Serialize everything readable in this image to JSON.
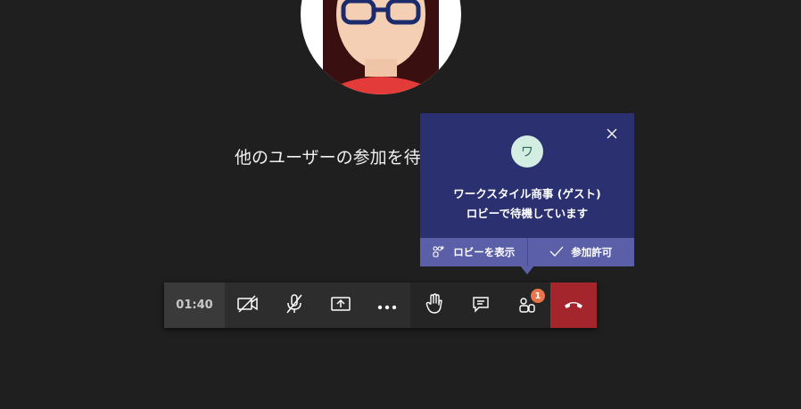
{
  "main": {
    "waiting_text": "他のユーザーの参加を待"
  },
  "lobby_popup": {
    "avatar_initial": "ワ",
    "participant_name": "ワークスタイル商事 (ゲスト)",
    "status": "ロビーで待機しています",
    "show_lobby_label": "ロビーを表示",
    "admit_label": "参加許可",
    "close_icon": "close-icon"
  },
  "toolbar": {
    "timer": "01:40",
    "participants_badge": "1",
    "icons": [
      "camera-off-icon",
      "mic-off-icon",
      "share-screen-icon",
      "more-icon",
      "raise-hand-icon",
      "chat-icon",
      "participants-icon",
      "hang-up-icon"
    ],
    "hangup_color": "#a4262c"
  },
  "colors": {
    "background": "#1f1f1f",
    "popup": "#2b3070",
    "popup_actions": "#5b5fa8",
    "badge": "#e8744a"
  }
}
